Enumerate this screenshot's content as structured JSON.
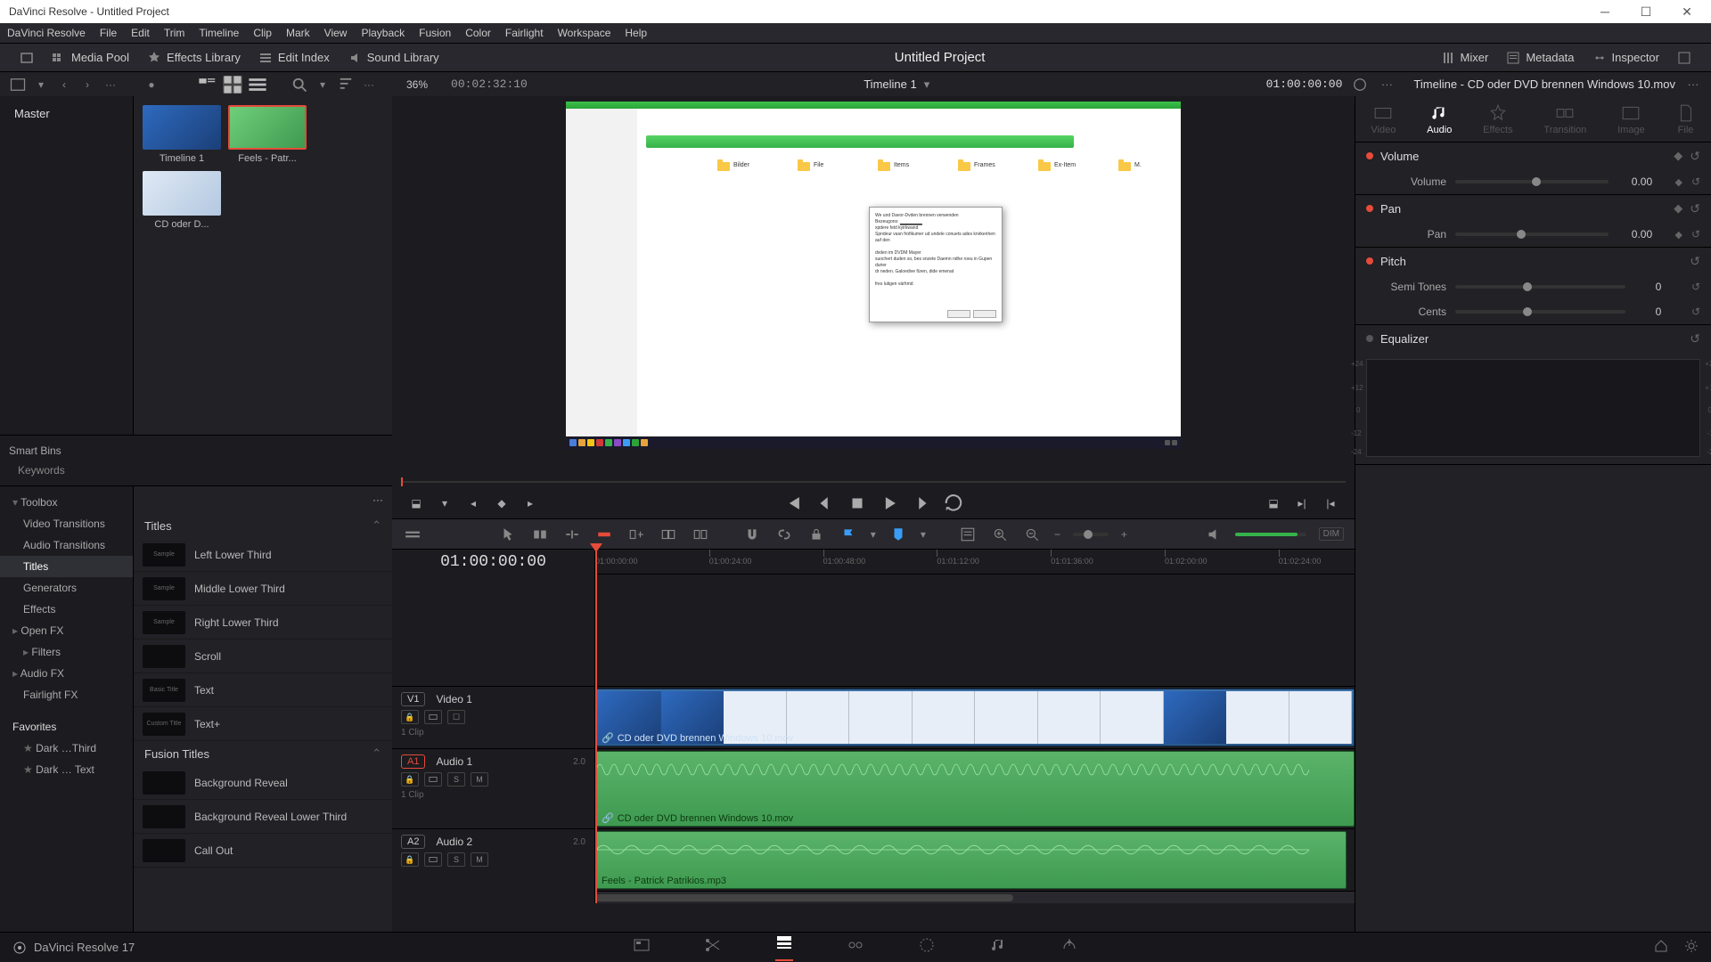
{
  "window": {
    "title": "DaVinci Resolve - Untitled Project"
  },
  "menu": [
    "DaVinci Resolve",
    "File",
    "Edit",
    "Trim",
    "Timeline",
    "Clip",
    "Mark",
    "View",
    "Playback",
    "Fusion",
    "Color",
    "Fairlight",
    "Workspace",
    "Help"
  ],
  "toptoolbar": {
    "media_pool": "Media Pool",
    "effects_library": "Effects Library",
    "edit_index": "Edit Index",
    "sound_library": "Sound Library",
    "mixer": "Mixer",
    "metadata": "Metadata",
    "inspector": "Inspector"
  },
  "project_name": "Untitled Project",
  "subbar": {
    "zoom": "36%",
    "duration": "00:02:32:10",
    "timeline_name": "Timeline 1",
    "timeline_tc": "01:00:00:00",
    "inspector_title": "Timeline - CD oder DVD brennen Windows 10.mov"
  },
  "mediapool": {
    "master": "Master",
    "items": [
      {
        "label": "Timeline 1",
        "c1": "#2e6abf",
        "c2": "#1b3f78"
      },
      {
        "label": "Feels - Patr...",
        "c1": "#6fcf7a",
        "c2": "#3e9a50",
        "selected": true
      },
      {
        "label": "CD oder D...",
        "c1": "#dfe9f5",
        "c2": "#b3c8e0"
      }
    ]
  },
  "smartbins": {
    "title": "Smart Bins",
    "keywords": "Keywords"
  },
  "fxnav": {
    "toolbox": "Toolbox",
    "items": [
      "Video Transitions",
      "Audio Transitions",
      "Titles",
      "Generators",
      "Effects"
    ],
    "openfx": "Open FX",
    "filters": "Filters",
    "audiofx": "Audio FX",
    "fairlightfx": "Fairlight FX",
    "favorites": "Favorites",
    "fav1": "Dark …Third",
    "fav2": "Dark … Text"
  },
  "fxlist": {
    "titles_hdr": "Titles",
    "titles": [
      "Left Lower Third",
      "Middle Lower Third",
      "Right Lower Third",
      "Scroll",
      "Text",
      "Text+"
    ],
    "title_swatches": [
      "Sample",
      "Sample",
      "Sample",
      "",
      "Basic Title",
      "Custom Title"
    ],
    "fusion_hdr": "Fusion Titles",
    "fusion": [
      "Background Reveal",
      "Background Reveal Lower Third",
      "Call Out"
    ]
  },
  "inspector": {
    "tabs": [
      "Video",
      "Audio",
      "Effects",
      "Transition",
      "Image",
      "File"
    ],
    "volume_hdr": "Volume",
    "volume_lbl": "Volume",
    "volume_val": "0.00",
    "pan_hdr": "Pan",
    "pan_lbl": "Pan",
    "pan_val": "0.00",
    "pitch_hdr": "Pitch",
    "semitones_lbl": "Semi Tones",
    "semitones_val": "0",
    "cents_lbl": "Cents",
    "cents_val": "0",
    "eq_hdr": "Equalizer",
    "eq_labels": [
      "+24",
      "+12",
      "0",
      "-12",
      "-24"
    ]
  },
  "timeline": {
    "tc": "01:00:00:00",
    "ruler": [
      "01:00:00:00",
      "01:00:24:00",
      "01:00:48:00",
      "01:01:12:00",
      "01:01:36:00",
      "01:02:00:00",
      "01:02:24:00"
    ],
    "tracks": {
      "v1": {
        "badge": "V1",
        "name": "Video 1",
        "clips": "1 Clip"
      },
      "a1": {
        "badge": "A1",
        "name": "Audio 1",
        "ch": "2.0",
        "clips": "1 Clip"
      },
      "a2": {
        "badge": "A2",
        "name": "Audio 2",
        "ch": "2.0"
      }
    },
    "clip_linked": "CD oder DVD brennen Windows 10.mov",
    "clip_a2": "Feels - Patrick Patrikios.mp3"
  },
  "footer": {
    "app": "DaVinci Resolve 17"
  },
  "viewer": {
    "folders": [
      "Bilder",
      "File",
      "Items",
      "Frames",
      "Ex-Item",
      "M."
    ]
  },
  "dim": "DIM"
}
